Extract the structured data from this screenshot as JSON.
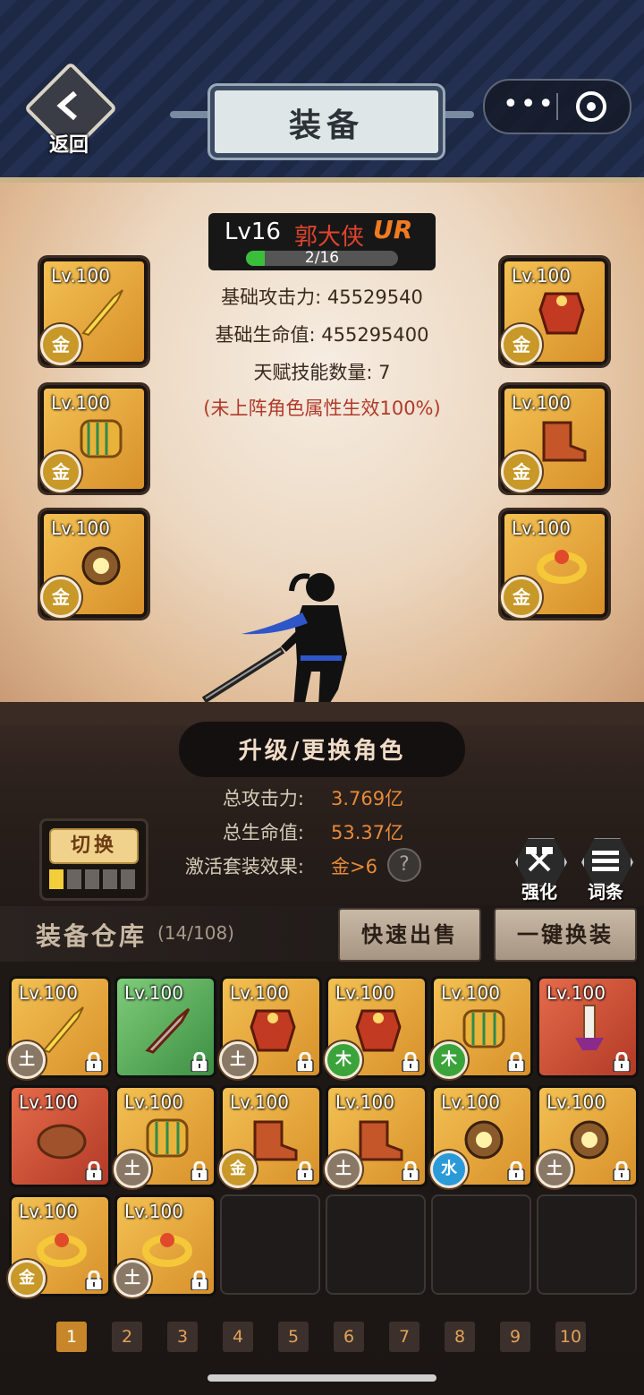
{
  "header": {
    "back_label": "返回",
    "title": "装备",
    "capsule_more": "•••"
  },
  "hero": {
    "level": "Lv16",
    "name": "郭大侠",
    "rarity": "UR",
    "progress_text": "2/16",
    "progress_fraction": 0.125,
    "base_attack": "基础攻击力: 45529540",
    "base_hp": "基础生命值: 455295400",
    "talent_count": "天赋技能数量: 7",
    "note": "(未上阵角色属性生效100%)"
  },
  "equip_slots": [
    {
      "level": "Lv.100",
      "badge": "金",
      "icon": "sword-icon"
    },
    {
      "level": "Lv.100",
      "badge": "金",
      "icon": "armor-icon"
    },
    {
      "level": "Lv.100",
      "badge": "金",
      "icon": "bracer-icon"
    },
    {
      "level": "Lv.100",
      "badge": "金",
      "icon": "boots-icon"
    },
    {
      "level": "Lv.100",
      "badge": "金",
      "icon": "amulet-icon"
    },
    {
      "level": "Lv.100",
      "badge": "金",
      "icon": "ring-icon"
    }
  ],
  "upgrade": {
    "label": "升级/更换角色"
  },
  "totals": {
    "attack_label": "总攻击力:",
    "attack_value": "3.769亿",
    "hp_label": "总生命值:",
    "hp_value": "53.37亿",
    "set_label": "激活套装效果:",
    "set_value": "金>6",
    "help": "?"
  },
  "switch": {
    "label": "切换",
    "pips_active": 1,
    "pips_total": 5
  },
  "tools": {
    "enhance_label": "强化",
    "affix_label": "词条"
  },
  "warehouse": {
    "title": "装备仓库",
    "count": "(14/108)",
    "quick_sell": "快速出售",
    "one_click": "一键换装"
  },
  "inventory": [
    {
      "level": "Lv.100",
      "badge": "土",
      "bg": "gold",
      "icon": "sword-icon"
    },
    {
      "level": "Lv.100",
      "badge": "",
      "bg": "green",
      "icon": "dagger-icon"
    },
    {
      "level": "Lv.100",
      "badge": "土",
      "bg": "gold",
      "icon": "armor-icon"
    },
    {
      "level": "Lv.100",
      "badge": "木",
      "bg": "gold",
      "icon": "armor-icon"
    },
    {
      "level": "Lv.100",
      "badge": "木",
      "bg": "gold",
      "icon": "bracer-icon"
    },
    {
      "level": "Lv.100",
      "badge": "",
      "bg": "red",
      "icon": "blade-icon"
    },
    {
      "level": "Lv.100",
      "badge": "",
      "bg": "red",
      "icon": "shield-icon"
    },
    {
      "level": "Lv.100",
      "badge": "土",
      "bg": "gold",
      "icon": "bracer-icon"
    },
    {
      "level": "Lv.100",
      "badge": "金",
      "bg": "gold",
      "icon": "boots-icon"
    },
    {
      "level": "Lv.100",
      "badge": "土",
      "bg": "gold",
      "icon": "boots-icon"
    },
    {
      "level": "Lv.100",
      "badge": "水",
      "bg": "gold",
      "icon": "amulet-icon"
    },
    {
      "level": "Lv.100",
      "badge": "土",
      "bg": "gold",
      "icon": "amulet-icon"
    },
    {
      "level": "Lv.100",
      "badge": "金",
      "bg": "gold",
      "icon": "ring-icon"
    },
    {
      "level": "Lv.100",
      "badge": "土",
      "bg": "gold",
      "icon": "ring-icon"
    }
  ],
  "empty_slots": 4,
  "pages": [
    "1",
    "2",
    "3",
    "4",
    "5",
    "6",
    "7",
    "8",
    "9",
    "10"
  ],
  "active_page": "1",
  "colors": {
    "accent": "#c8862a",
    "rarity": "#f07b22",
    "name": "#e0442e"
  }
}
